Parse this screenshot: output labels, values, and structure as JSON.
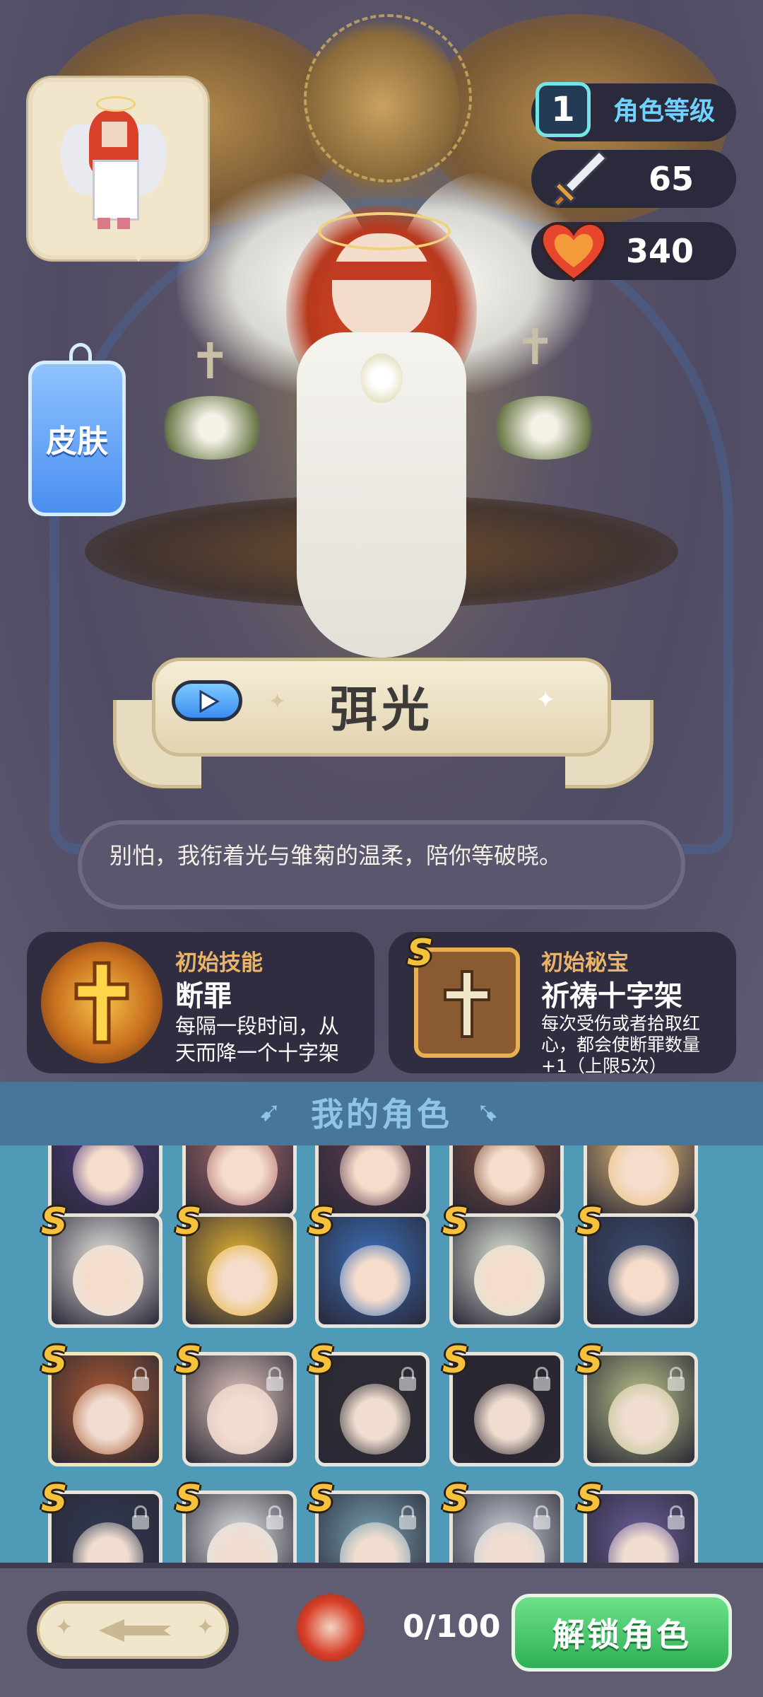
{
  "character": {
    "name": "弭光",
    "quote": "别怕，我衔着光与雏菊的温柔，陪你等破晓。",
    "skin_label": "皮肤"
  },
  "stats": {
    "level": "1",
    "level_label": "角色等级",
    "attack": "65",
    "hp": "340"
  },
  "skill": {
    "header": "初始技能",
    "name": "断罪",
    "desc_line1": "每隔一段时间，从",
    "desc_line2": "天而降一个十字架"
  },
  "treasure": {
    "header": "初始秘宝",
    "rank": "S",
    "name": "祈祷十字架",
    "desc_line1": "每次受伤或者拾取红",
    "desc_line2": "心，都会使断罪数量",
    "desc_line3": "+1（上限5次）"
  },
  "roster": {
    "title": "我的角色",
    "rank_label": "S",
    "rows": [
      {
        "cells": [
          {
            "color": "#4b3a7a",
            "locked": false
          },
          {
            "color": "#a86a6a",
            "locked": false
          },
          {
            "color": "#5a3a4a",
            "locked": false
          },
          {
            "color": "#7a4a3a",
            "locked": false
          },
          {
            "color": "#e8c07a",
            "locked": false
          }
        ]
      },
      {
        "cells": [
          {
            "color": "#e8e6e0",
            "locked": false
          },
          {
            "color": "#e6b430",
            "locked": false
          },
          {
            "color": "#3a6fb8",
            "locked": false
          },
          {
            "color": "#dfe6d6",
            "locked": false
          },
          {
            "color": "#3a4c70",
            "locked": false
          }
        ]
      },
      {
        "cells": [
          {
            "color": "#c2531f",
            "locked": true
          },
          {
            "color": "#e7c2b8",
            "locked": true
          },
          {
            "color": "#2d2b34",
            "locked": true
          },
          {
            "color": "#2a2430",
            "locked": true
          },
          {
            "color": "#b8c27a",
            "locked": true
          }
        ]
      },
      {
        "cells": [
          {
            "color": "#2d3a5a",
            "locked": true
          },
          {
            "color": "#dfe3e6",
            "locked": true
          },
          {
            "color": "#6aa0b8",
            "locked": true
          },
          {
            "color": "#c8d2e0",
            "locked": true
          },
          {
            "color": "#6a5aa8",
            "locked": true
          }
        ]
      }
    ]
  },
  "footer": {
    "count": "0/100",
    "unlock_label": "解锁角色"
  },
  "colors": {
    "gold": "#e9b36a",
    "rank_s": "#f6c23c",
    "unlock_green": "#2fb056",
    "level_cyan": "#6fd3ff"
  },
  "icons": [
    "sword-icon",
    "heart-icon",
    "play-icon",
    "cross-icon",
    "lock-icon",
    "back-arrow-icon",
    "character-avatar-icon"
  ]
}
